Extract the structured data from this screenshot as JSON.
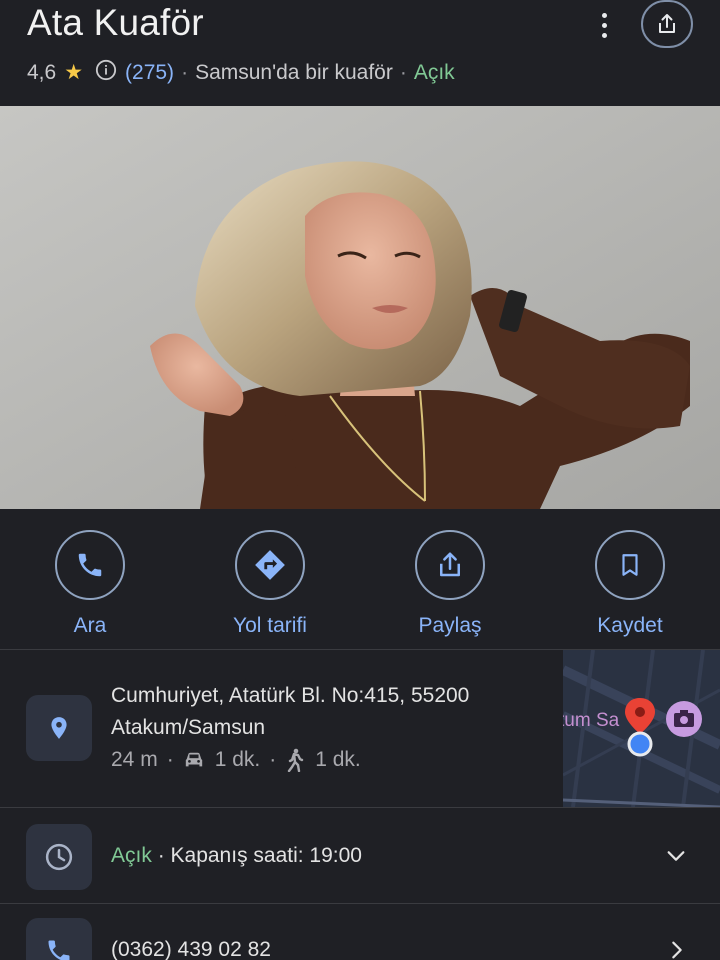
{
  "place": {
    "name": "Ata Kuaför",
    "rating": "4,6",
    "review_count": "(275)",
    "category": "Samsun'da bir kuaför",
    "status": "Açık",
    "separator": "·"
  },
  "actions": [
    {
      "label": "Ara",
      "icon": "phone-icon"
    },
    {
      "label": "Yol tarifi",
      "icon": "directions-icon"
    },
    {
      "label": "Paylaş",
      "icon": "share-icon"
    },
    {
      "label": "Kaydet",
      "icon": "bookmark-icon"
    }
  ],
  "address": {
    "line1": "Cumhuriyet, Atatürk Bl. No:415, 55200",
    "line2": "Atakum/Samsun",
    "distance": "24 m",
    "drive_time": "1 dk.",
    "walk_time": "1 dk.",
    "map_label": "tum Sa"
  },
  "hours": {
    "status": "Açık",
    "closing": "· Kapanış saati: 19:00"
  },
  "phone": {
    "number": "(0362) 439 02 82"
  },
  "colors": {
    "background": "#1f2025",
    "accent": "#8ab4f8",
    "open_green": "#81c995",
    "star": "#f7c948"
  }
}
